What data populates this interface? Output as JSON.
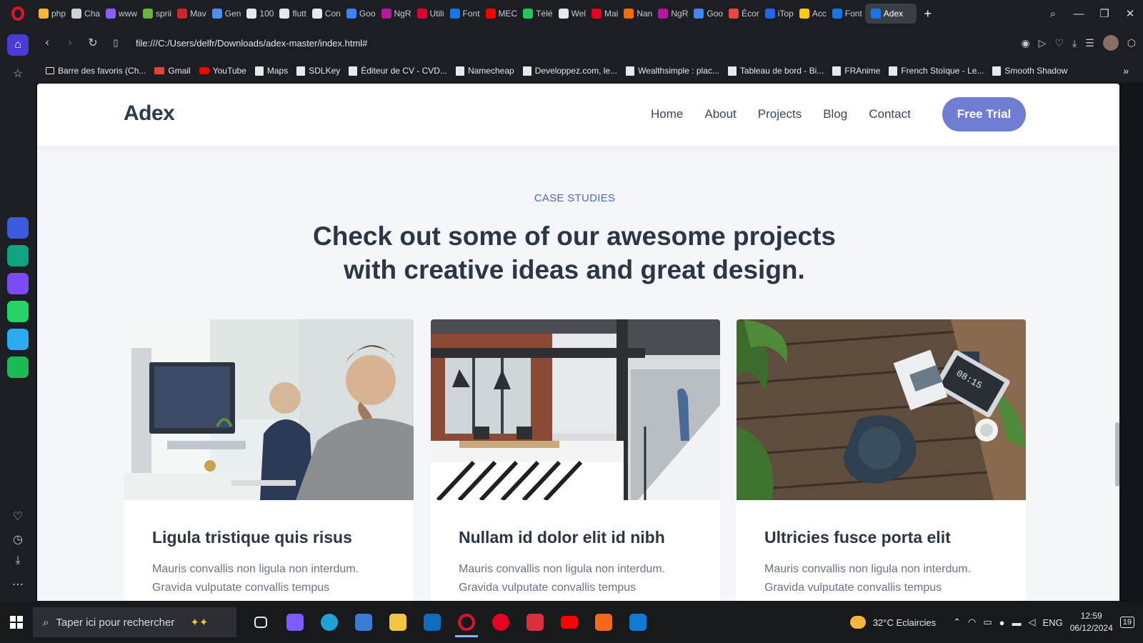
{
  "browser": {
    "tabs": [
      {
        "label": "php",
        "color": "#f4b63f"
      },
      {
        "label": "Cha",
        "color": "#cfd3d8"
      },
      {
        "label": "www",
        "color": "#8b5cf6"
      },
      {
        "label": "sprii",
        "color": "#6db33f"
      },
      {
        "label": "Mav",
        "color": "#d22128"
      },
      {
        "label": "Gen",
        "color": "#4f8cf7"
      },
      {
        "label": "100",
        "color": "#e6e8eb"
      },
      {
        "label": "flutt",
        "color": "#e6e8eb"
      },
      {
        "label": "Con",
        "color": "#e6e8eb"
      },
      {
        "label": "Goo",
        "color": "#3b82f6"
      },
      {
        "label": "NgR",
        "color": "#b5179e"
      },
      {
        "label": "Utili",
        "color": "#dd0031"
      },
      {
        "label": "Font",
        "color": "#1a73e8"
      },
      {
        "label": "MEC",
        "color": "#ff0000"
      },
      {
        "label": "Télé",
        "color": "#22c55e"
      },
      {
        "label": "Wel",
        "color": "#e6e8eb"
      },
      {
        "label": "Mai",
        "color": "#e60023"
      },
      {
        "label": "Nan",
        "color": "#ff6a00"
      },
      {
        "label": "NgR",
        "color": "#b5179e"
      },
      {
        "label": "Goo",
        "color": "#4285f4"
      },
      {
        "label": "Écor",
        "color": "#ef4444"
      },
      {
        "label": "iTop",
        "color": "#2563eb"
      },
      {
        "label": "Acc",
        "color": "#facc15"
      },
      {
        "label": "Font",
        "color": "#1a73e8"
      }
    ],
    "active_tab": "Adex",
    "new_tab": "+",
    "url": "file:///C:/Users/delfr/Downloads/adex-master/index.html#",
    "bookmarks": [
      {
        "label": "Barre des favoris (Ch...",
        "type": "folder"
      },
      {
        "label": "Gmail",
        "type": "gm"
      },
      {
        "label": "YouTube",
        "type": "yt"
      },
      {
        "label": "Maps",
        "type": "page"
      },
      {
        "label": "SDLKey",
        "type": "page"
      },
      {
        "label": "Éditeur de CV - CVD...",
        "type": "page"
      },
      {
        "label": "Namecheap",
        "type": "page"
      },
      {
        "label": "Developpez.com, le...",
        "type": "page"
      },
      {
        "label": "Wealthsimple : plac...",
        "type": "page"
      },
      {
        "label": "Tableau de bord - Bi...",
        "type": "page"
      },
      {
        "label": "FRAnime",
        "type": "page"
      },
      {
        "label": "French Stoïque - Le...",
        "type": "page"
      },
      {
        "label": "Smooth Shadow",
        "type": "page"
      }
    ]
  },
  "site": {
    "logo": "Adex",
    "nav": [
      "Home",
      "About",
      "Projects",
      "Blog",
      "Contact"
    ],
    "cta": "Free Trial",
    "eyebrow": "CASE STUDIES",
    "headline": "Check out some of our awesome projects with creative ideas and great design.",
    "cards": [
      {
        "title": "Ligula tristique quis risus",
        "text": "Mauris convallis non ligula non interdum. Gravida vulputate convallis tempus"
      },
      {
        "title": "Nullam id dolor elit id nibh",
        "text": "Mauris convallis non ligula non interdum. Gravida vulputate convallis tempus"
      },
      {
        "title": "Ultricies fusce porta elit",
        "text": "Mauris convallis non ligula non interdum. Gravida vulputate convallis tempus"
      }
    ]
  },
  "taskbar": {
    "search_placeholder": "Taper ici pour rechercher",
    "weather": "32°C  Eclaircies",
    "language": "ENG",
    "time": "12:59",
    "date": "06/12/2024",
    "notifications": "19"
  },
  "colors": {
    "accent": "#6f7ed3",
    "eyebrow": "#5565b8",
    "heading": "#2c3644"
  }
}
